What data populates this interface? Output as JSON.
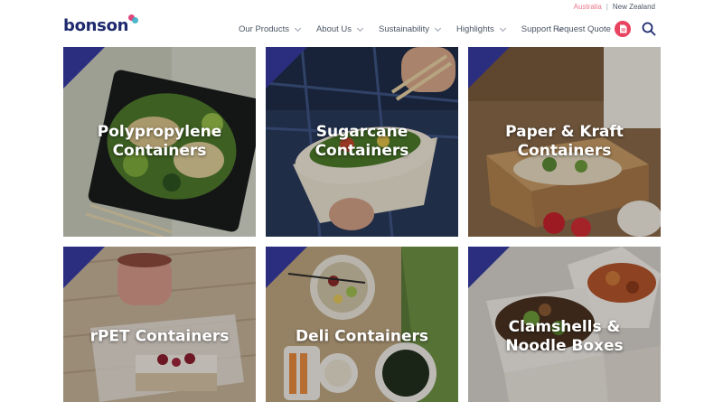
{
  "header": {
    "regions": {
      "australia": "Australia",
      "separator": "|",
      "new_zealand": "New Zealand"
    },
    "logo_text": "bonson",
    "nav": [
      {
        "label": "Our Products"
      },
      {
        "label": "About Us"
      },
      {
        "label": "Sustainability"
      },
      {
        "label": "Highlights"
      },
      {
        "label": "Support"
      }
    ],
    "quote_label": "Request Quote",
    "icons": {
      "quote": "document-icon",
      "search": "search-icon",
      "dropdown": "chevron-down-icon"
    },
    "colors": {
      "brand_navy": "#1f2a6e",
      "accent_pink": "#e8435f",
      "region_active": "#e8758a"
    }
  },
  "products": [
    {
      "title": "Polypropylene Containers"
    },
    {
      "title": "Sugarcane Containers"
    },
    {
      "title": "Paper & Kraft Containers"
    },
    {
      "title": "rPET Containers"
    },
    {
      "title": "Deli Containers"
    },
    {
      "title": "Clamshells & Noodle Boxes"
    }
  ]
}
